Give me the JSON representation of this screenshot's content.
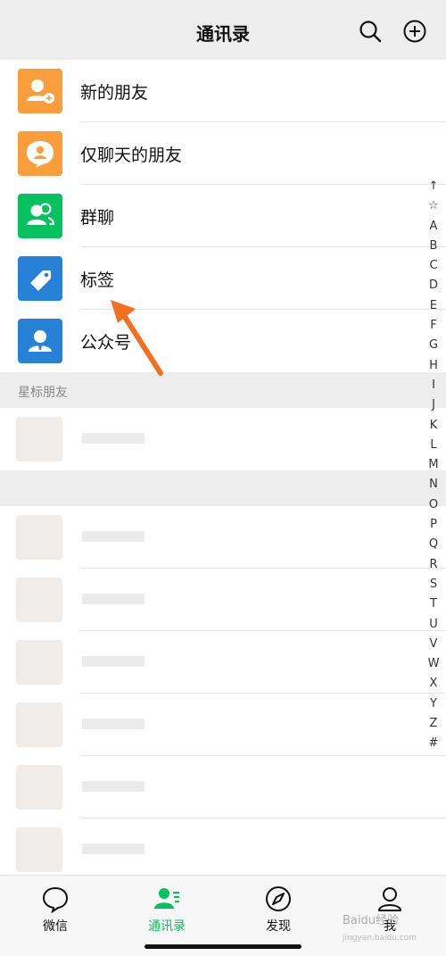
{
  "header": {
    "title": "通讯录",
    "search_icon": "search-icon",
    "add_icon": "plus-circle-icon"
  },
  "functions": [
    {
      "label": "新的朋友",
      "icon": "add-friend-icon",
      "color": "#fa9d3b"
    },
    {
      "label": "仅聊天的朋友",
      "icon": "chat-only-icon",
      "color": "#fa9d3b"
    },
    {
      "label": "群聊",
      "icon": "group-chat-icon",
      "color": "#07c160"
    },
    {
      "label": "标签",
      "icon": "tag-icon",
      "color": "#2782d7"
    },
    {
      "label": "公众号",
      "icon": "official-account-icon",
      "color": "#2782d7"
    }
  ],
  "section": {
    "starred_label": "星标朋友"
  },
  "index_letters": [
    "↑",
    "☆",
    "A",
    "B",
    "C",
    "D",
    "E",
    "F",
    "G",
    "H",
    "I",
    "J",
    "K",
    "L",
    "M",
    "N",
    "O",
    "P",
    "Q",
    "R",
    "S",
    "T",
    "U",
    "V",
    "W",
    "X",
    "Y",
    "Z",
    "#"
  ],
  "tabs": [
    {
      "label": "微信",
      "icon": "chat-bubble-icon",
      "active": false
    },
    {
      "label": "通讯录",
      "icon": "contacts-icon",
      "active": true
    },
    {
      "label": "发现",
      "icon": "compass-icon",
      "active": false
    },
    {
      "label": "我",
      "icon": "profile-icon",
      "active": false
    }
  ],
  "watermark": {
    "text": "Baidu经验",
    "sub": "jingyan.baidu.com"
  },
  "colors": {
    "accent": "#07c160",
    "orange": "#fa9d3b",
    "blue": "#2782d7",
    "arrow": "#f37021"
  }
}
